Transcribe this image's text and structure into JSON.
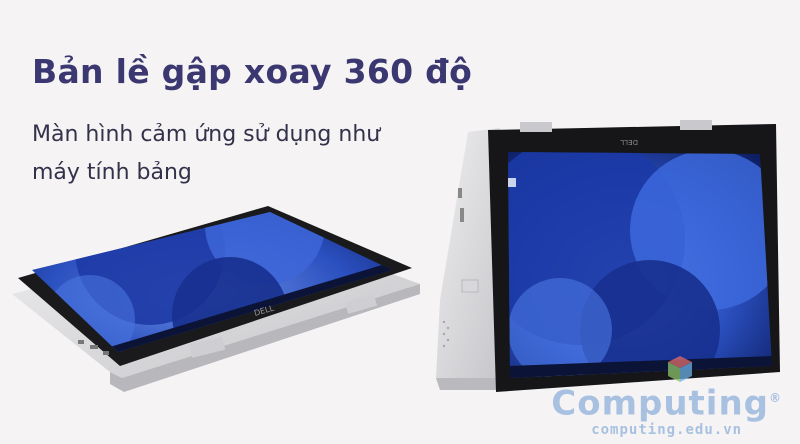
{
  "headline": "Bản lề gập xoay 360 độ",
  "subheadline": "Màn hình cảm ứng sử dụng như máy tính bảng",
  "laptop_logo": "DELL",
  "watermark": {
    "brand": "Computing",
    "registered": "®",
    "url": "computing.edu.vn"
  },
  "colors": {
    "headline": "#3b3770",
    "screen_blue": "#1e3fa8",
    "chassis": "#d9d9dc"
  }
}
